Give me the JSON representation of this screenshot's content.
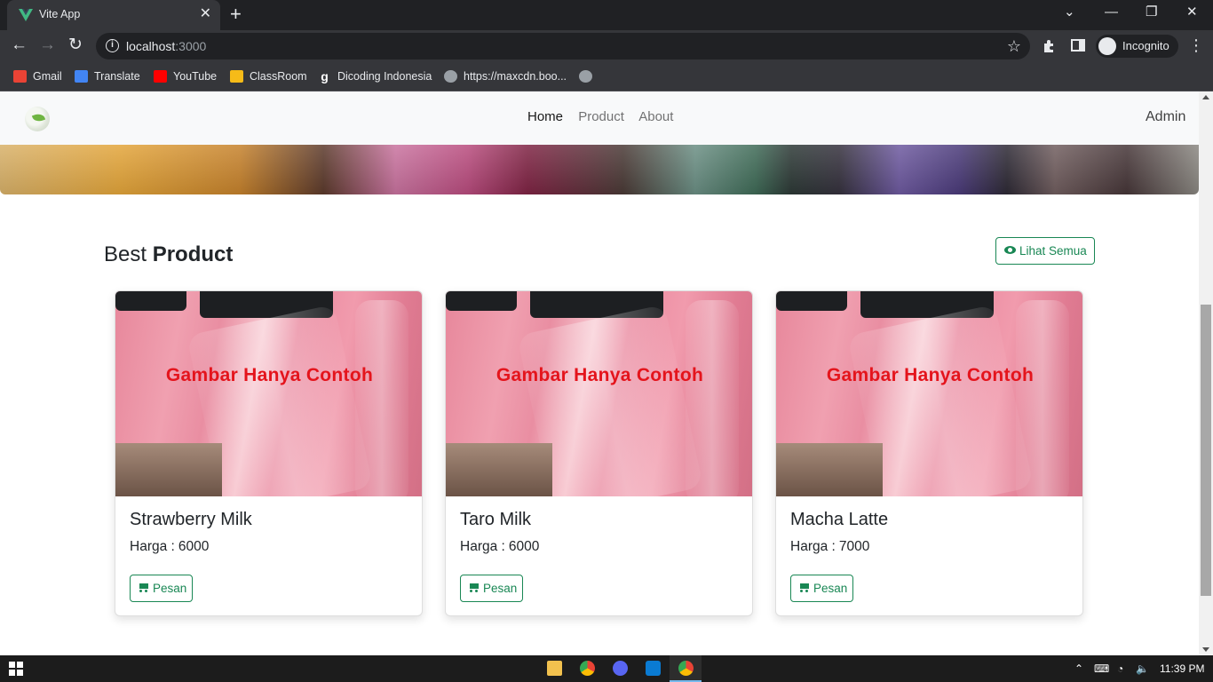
{
  "browser": {
    "tab_title": "Vite App",
    "url_host": "localhost",
    "url_port": ":3000",
    "profile_label": "Incognito",
    "bookmarks": [
      {
        "label": "Gmail",
        "icon": "gmail-icon",
        "color": "#ea4335"
      },
      {
        "label": "Translate",
        "icon": "translate-icon",
        "color": "#4285f4"
      },
      {
        "label": "YouTube",
        "icon": "youtube-icon",
        "color": "#ff0000"
      },
      {
        "label": "ClassRoom",
        "icon": "classroom-icon",
        "color": "#f6bb18"
      },
      {
        "label": "Dicoding Indonesia",
        "icon": "dicoding-icon",
        "color": "#ffffff"
      },
      {
        "label": "https://maxcdn.boo...",
        "icon": "globe-icon",
        "color": "#9aa0a6"
      }
    ]
  },
  "navbar": {
    "links": [
      "Home",
      "Product",
      "About"
    ],
    "active": "Home",
    "user": "Admin"
  },
  "section": {
    "title_light": "Best",
    "title_bold": "Product",
    "see_all_label": "Lihat Semua"
  },
  "products": [
    {
      "name": "Strawberry Milk",
      "price_label": "Harga :",
      "price": "6000",
      "image_caption": "Gambar Hanya Contoh",
      "order_label": "Pesan"
    },
    {
      "name": "Taro Milk",
      "price_label": "Harga :",
      "price": "6000",
      "image_caption": "Gambar Hanya Contoh",
      "order_label": "Pesan"
    },
    {
      "name": "Macha Latte",
      "price_label": "Harga :",
      "price": "7000",
      "image_caption": "Gambar Hanya Contoh",
      "order_label": "Pesan"
    }
  ],
  "taskbar": {
    "clock": "11:39 PM",
    "apps": [
      "file-explorer-icon",
      "chrome-icon",
      "discord-icon",
      "vscode-icon",
      "chrome-icon"
    ]
  },
  "colors": {
    "accent_green": "#198754",
    "watermark_red": "#e4141c"
  }
}
